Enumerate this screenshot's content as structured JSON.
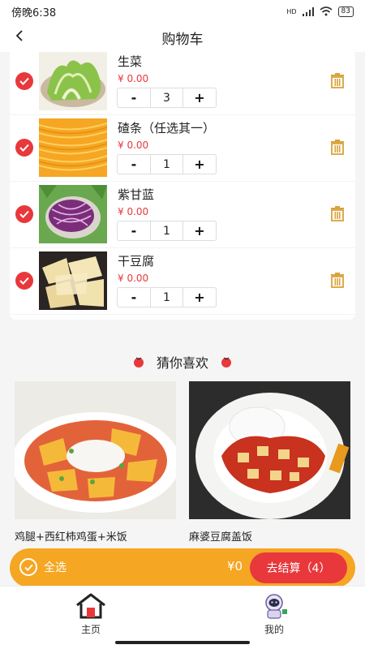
{
  "status_bar": {
    "time": "傍晚6:38",
    "signal_label": "HD",
    "battery": "83"
  },
  "header": {
    "title": "购物车"
  },
  "cart": {
    "items": [
      {
        "name": "生菜",
        "price": "¥ 0.00",
        "quantity": "3",
        "minus": "-",
        "plus": "+",
        "image": "lettuce",
        "checked": true
      },
      {
        "name": "碴条（任选其一）",
        "price": "¥ 0.00",
        "quantity": "1",
        "minus": "-",
        "plus": "+",
        "image": "noodle-strips",
        "checked": true
      },
      {
        "name": "紫甘蓝",
        "price": "¥ 0.00",
        "quantity": "1",
        "minus": "-",
        "plus": "+",
        "image": "purple-cabbage",
        "checked": true
      },
      {
        "name": "干豆腐",
        "price": "¥ 0.00",
        "quantity": "1",
        "minus": "-",
        "plus": "+",
        "image": "dried-tofu",
        "checked": true
      }
    ]
  },
  "recommend": {
    "title": "猜你喜欢",
    "products": [
      {
        "name": "鸡腿+西红柿鸡蛋+米饭",
        "image": "tomato-egg-rice"
      },
      {
        "name": "麻婆豆腐盖饭",
        "image": "mapo-tofu-rice"
      }
    ]
  },
  "checkout": {
    "select_all_label": "全选",
    "total": "¥0",
    "button_label": "去结算（4）"
  },
  "tabs": [
    {
      "label": "主页",
      "icon": "home-icon"
    },
    {
      "label": "我的",
      "icon": "astronaut-avatar-icon"
    }
  ],
  "colors": {
    "accent_red": "#e8383c",
    "accent_orange": "#f5a623",
    "trash_gold": "#d9a33a"
  }
}
